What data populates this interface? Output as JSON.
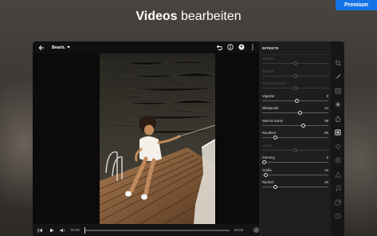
{
  "headline": {
    "bold": "Videos",
    "rest": " bearbeiten"
  },
  "premium_label": "Premium",
  "topbar": {
    "edit_label": "Bearb."
  },
  "panel": {
    "title": "EFFEKTE",
    "sliders": [
      {
        "label": "Struktur",
        "value": "",
        "enabled": false,
        "level": 0.5
      },
      {
        "label": "Klarheit",
        "value": "",
        "enabled": false,
        "level": 0.5
      },
      {
        "label": "Dunst entfernen",
        "value": "",
        "enabled": false,
        "level": 0.5
      },
      {
        "label": "Vignette",
        "value": "8",
        "enabled": true,
        "level": 0.53
      },
      {
        "label": "Mittelpunkt",
        "value": "14",
        "enabled": true,
        "level": 0.57
      },
      {
        "label": "Weiche Kante",
        "value": "58",
        "enabled": true,
        "level": 0.62
      },
      {
        "label": "Rundheit",
        "value": "-66",
        "enabled": true,
        "level": 0.2
      },
      {
        "label": "Lichter",
        "value": "",
        "enabled": false,
        "level": 0.5
      },
      {
        "label": "Körnung",
        "value": "6",
        "enabled": true,
        "level": 0.03
      },
      {
        "label": "Größe",
        "value": "10",
        "enabled": true,
        "level": 0.05
      },
      {
        "label": "Rauheit",
        "value": "20",
        "enabled": true,
        "level": 0.2
      }
    ]
  },
  "playbar": {
    "current_time": "00:00",
    "end_time": "00:09",
    "progress": 0.0
  },
  "colors": {
    "accent": "#1473e6",
    "panel_bg": "#1e1e1e"
  }
}
